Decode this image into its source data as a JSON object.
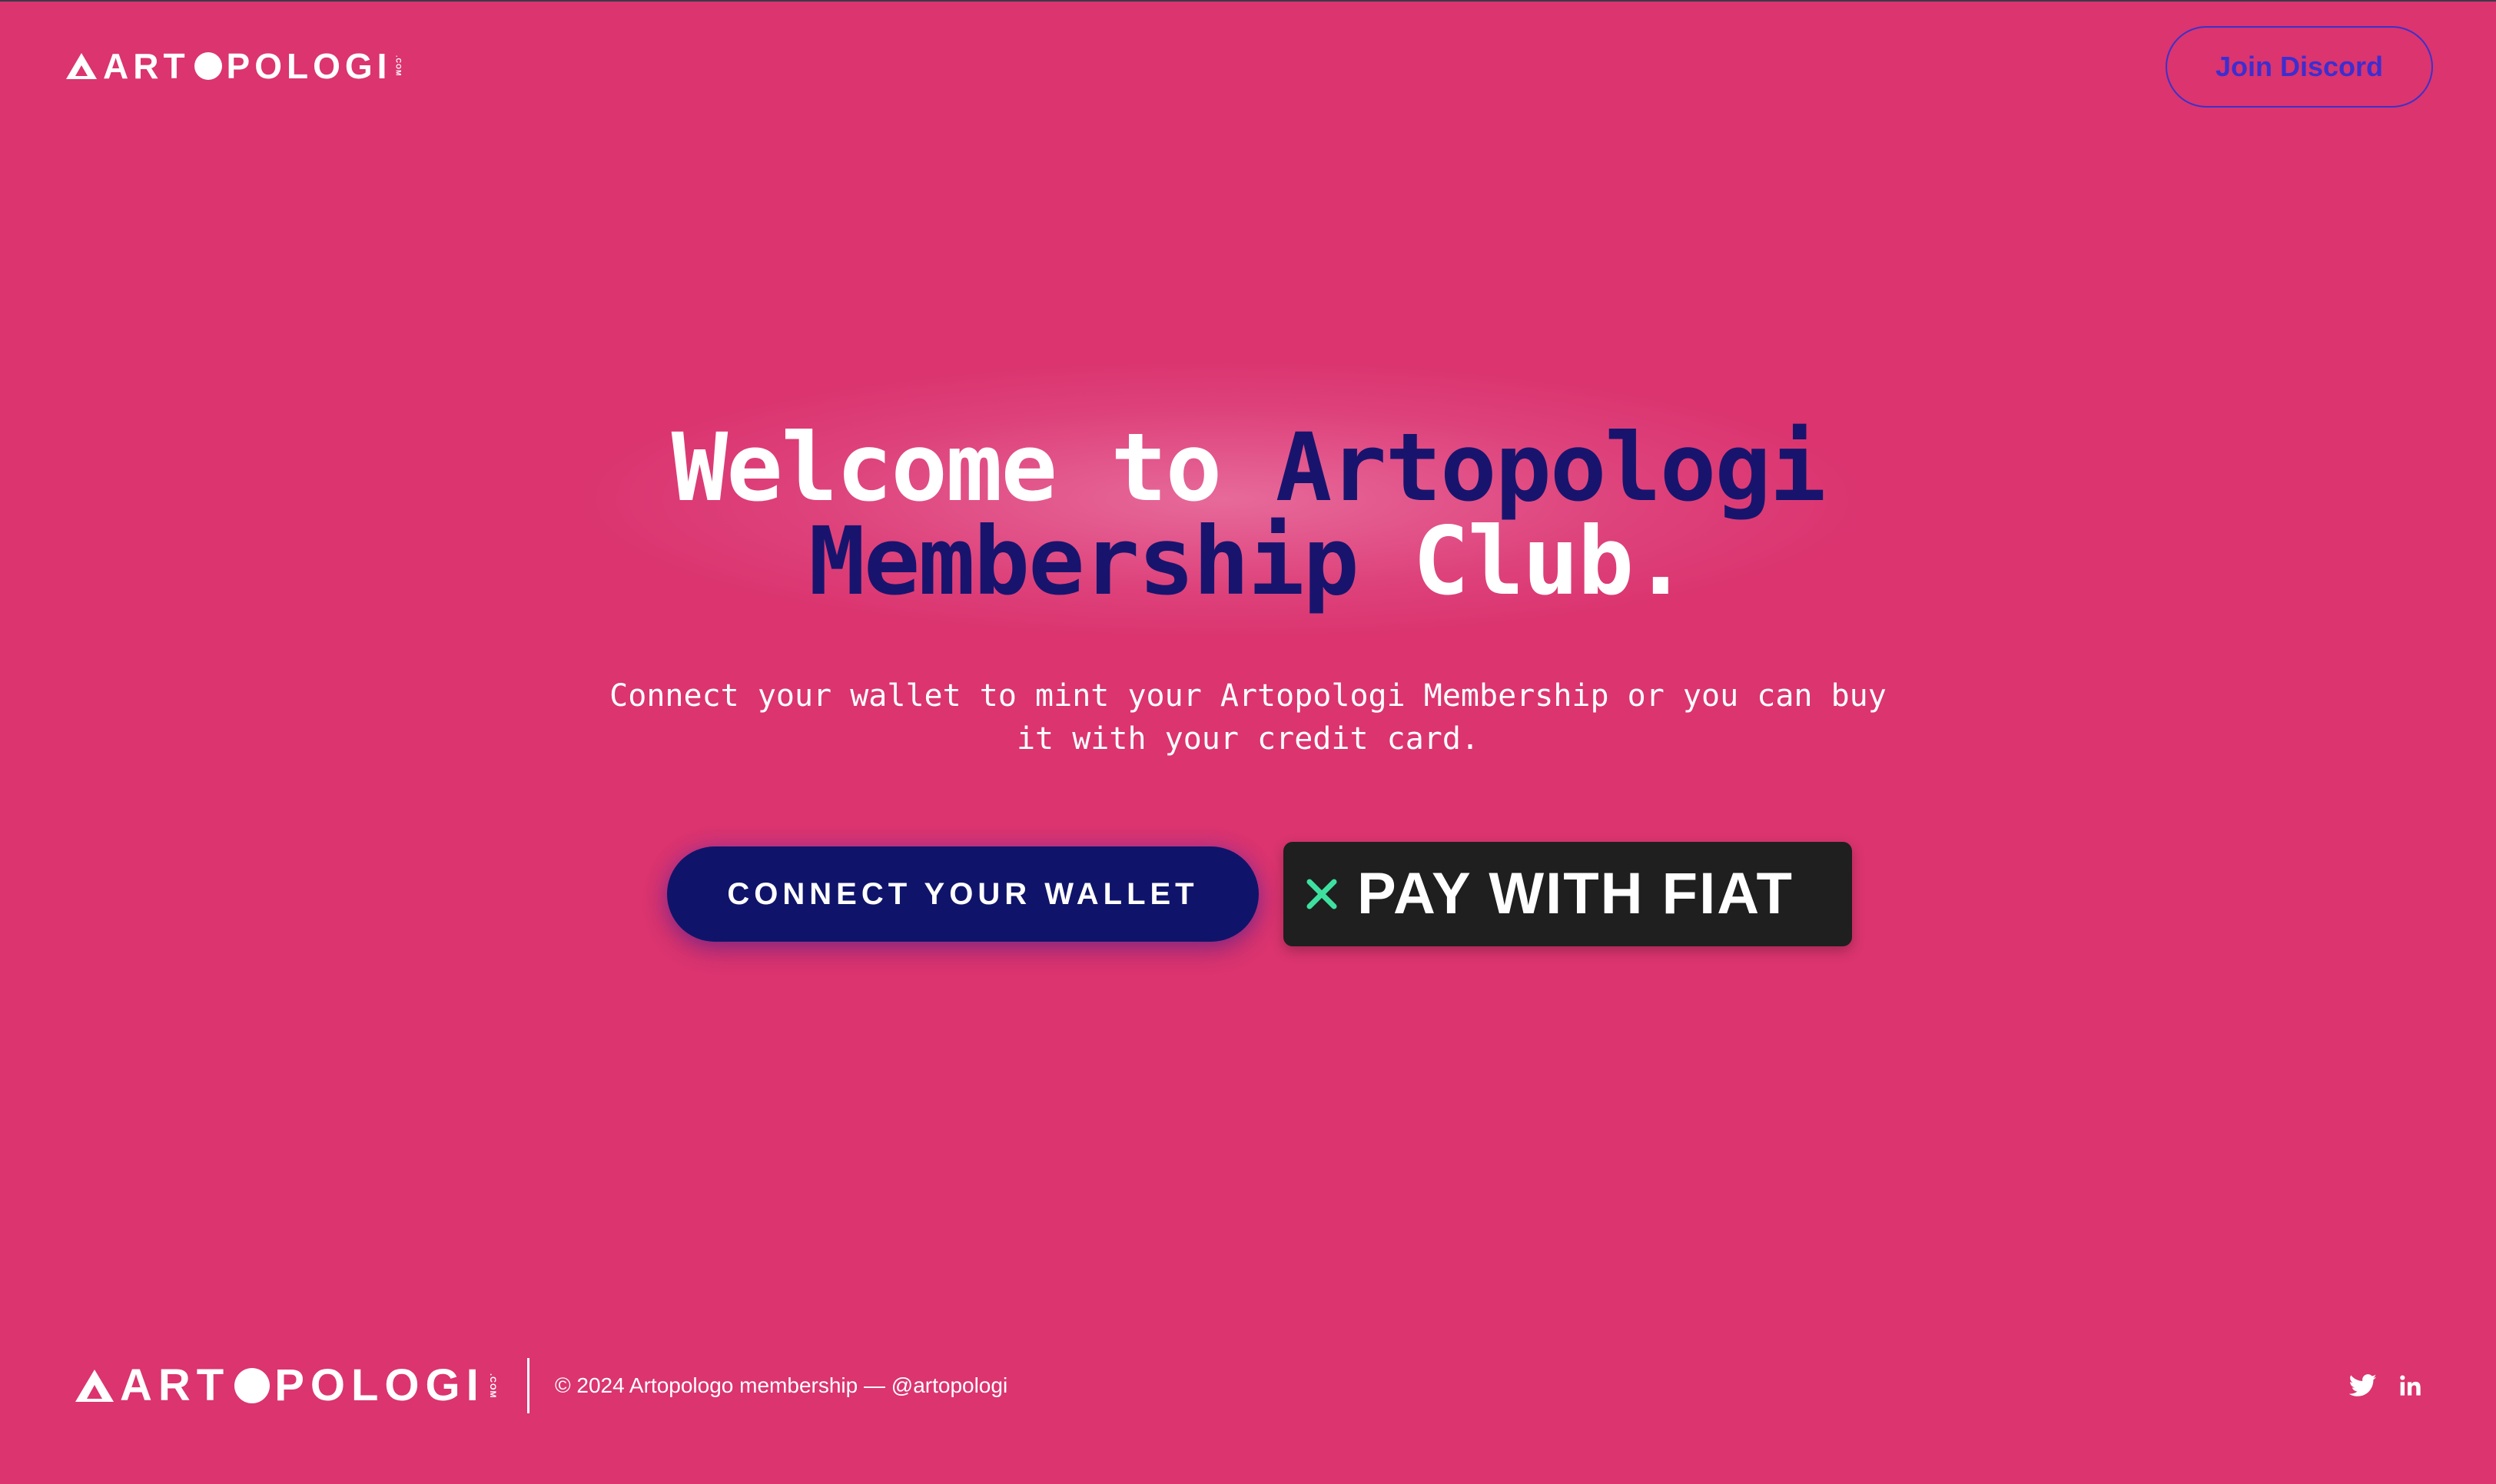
{
  "header": {
    "logo_text_left": "ART",
    "logo_text_right": "POLOGI",
    "logo_suffix": ".COM",
    "discord_button": "Join Discord"
  },
  "hero": {
    "title_line1_white": "Welcome to",
    "title_line1_navy": "Artopologi",
    "title_line2_navy": "Membership",
    "title_line2_white": "Club.",
    "subtitle_line1": "Connect your wallet to mint your Artopologi Membership or you can buy",
    "subtitle_line2": "it with your credit card.",
    "connect_button": "CONNECT YOUR WALLET",
    "fiat_button": "PAY WITH FIAT"
  },
  "footer": {
    "logo_text_left": "ART",
    "logo_text_right": "POLOGI",
    "logo_suffix": ".COM",
    "copyright": "© 2024 Artopologo membership — ",
    "handle": "@artopologi",
    "social_icons": [
      "twitter-icon",
      "linkedin-icon"
    ]
  },
  "colors": {
    "background": "#db346f",
    "navy": "#18146e",
    "button_navy": "#0f146a",
    "discord_purple": "#3d2ed0",
    "fiat_dark": "#1f1f1f",
    "fiat_icon_green": "#3ee0a0"
  }
}
